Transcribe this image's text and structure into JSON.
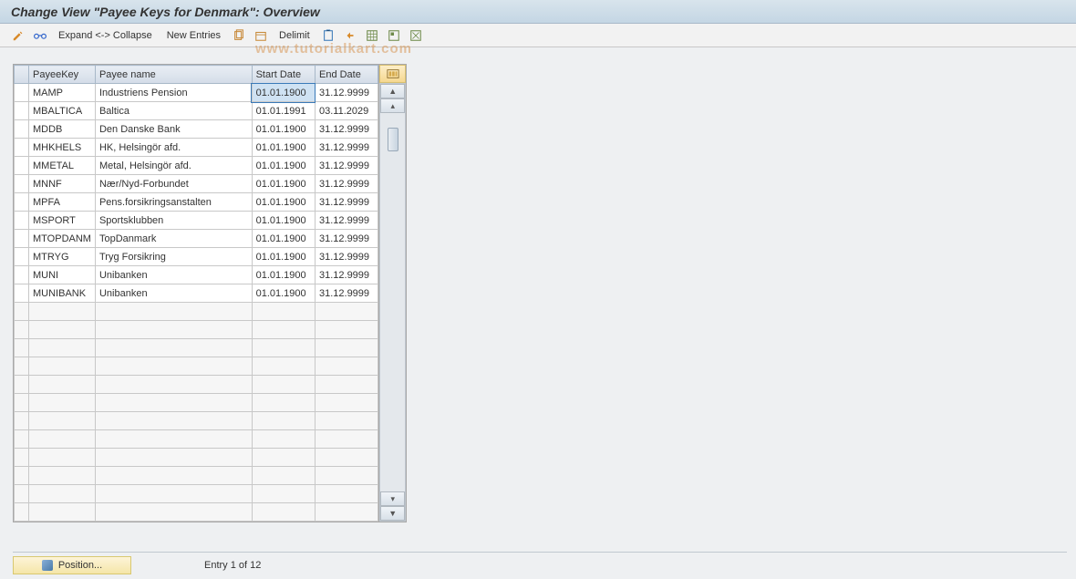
{
  "title": "Change View \"Payee Keys for Denmark\": Overview",
  "toolbar": {
    "expand_collapse": "Expand <-> Collapse",
    "new_entries": "New Entries",
    "delimit": "Delimit"
  },
  "table": {
    "headers": {
      "key": "PayeeKey",
      "name": "Payee name",
      "start": "Start Date",
      "end": "End Date"
    },
    "rows": [
      {
        "key": "MAMP",
        "name": "Industriens Pension",
        "start": "01.01.1900",
        "end": "31.12.9999"
      },
      {
        "key": "MBALTICA",
        "name": "Baltica",
        "start": "01.01.1991",
        "end": "03.11.2029"
      },
      {
        "key": "MDDB",
        "name": "Den Danske Bank",
        "start": "01.01.1900",
        "end": "31.12.9999"
      },
      {
        "key": "MHKHELS",
        "name": "HK, Helsingör afd.",
        "start": "01.01.1900",
        "end": "31.12.9999"
      },
      {
        "key": "MMETAL",
        "name": "Metal, Helsingör afd.",
        "start": "01.01.1900",
        "end": "31.12.9999"
      },
      {
        "key": "MNNF",
        "name": "Nær/Nyd-Forbundet",
        "start": "01.01.1900",
        "end": "31.12.9999"
      },
      {
        "key": "MPFA",
        "name": "Pens.forsikringsanstalten",
        "start": "01.01.1900",
        "end": "31.12.9999"
      },
      {
        "key": "MSPORT",
        "name": "Sportsklubben",
        "start": "01.01.1900",
        "end": "31.12.9999"
      },
      {
        "key": "MTOPDANM",
        "name": "TopDanmark",
        "start": "01.01.1900",
        "end": "31.12.9999"
      },
      {
        "key": "MTRYG",
        "name": "Tryg Forsikring",
        "start": "01.01.1900",
        "end": "31.12.9999"
      },
      {
        "key": "MUNI",
        "name": "Unibanken",
        "start": "01.01.1900",
        "end": "31.12.9999"
      },
      {
        "key": "MUNIBANK",
        "name": "Unibanken",
        "start": "01.01.1900",
        "end": "31.12.9999"
      }
    ],
    "empty_rows": 12
  },
  "footer": {
    "position_label": "Position...",
    "entry_text": "Entry 1 of 12"
  },
  "watermark": "www.tutorialkart.com"
}
